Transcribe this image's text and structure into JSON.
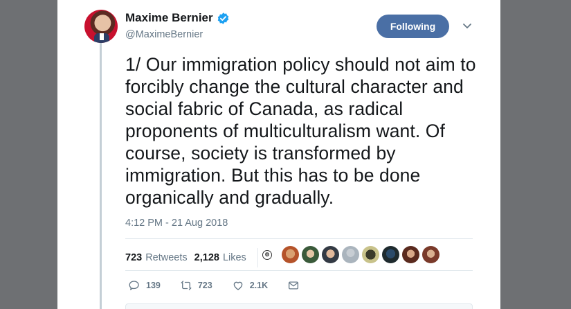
{
  "user": {
    "display_name": "Maxime Bernier",
    "handle": "@MaximeBernier",
    "follow_label": "Following"
  },
  "tweet": {
    "text": "1/ Our immigration policy should not aim to forcibly change the cultural character and social fabric of Canada, as radical proponents of multiculturalism want. Of course, society is transformed by immigration. But this has to be done organically and gradually.",
    "timestamp": "4:12 PM - 21 Aug 2018"
  },
  "stats": {
    "retweets_count": "723",
    "retweets_label": "Retweets",
    "likes_count": "2,128",
    "likes_label": "Likes"
  },
  "actions": {
    "replies": "139",
    "retweets": "723",
    "likes": "2.1K"
  },
  "colors": {
    "follow_button": "#4a6fa5",
    "verified": "#1da1f2",
    "backdrop": "#6e7073"
  }
}
